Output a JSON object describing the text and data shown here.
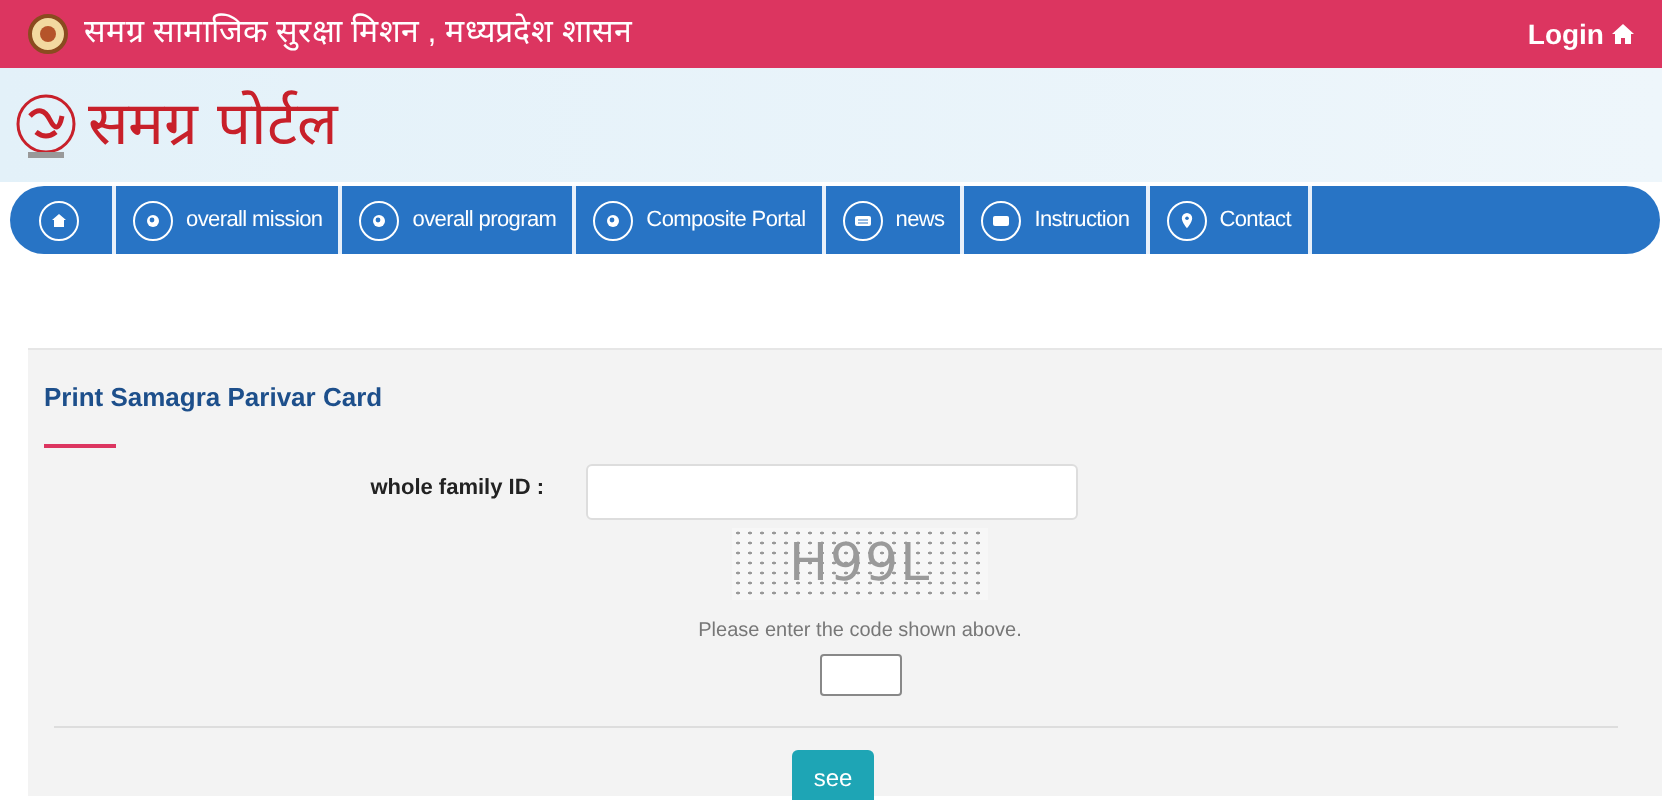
{
  "top_bar": {
    "title": "समग्र सामाजिक सुरक्षा मिशन , मध्यप्रदेश शासन",
    "login": "Login"
  },
  "logo": {
    "text": "समग्र पोर्टल"
  },
  "nav": [
    {
      "kind": "home"
    },
    {
      "kind": "dot",
      "label": "overall mission"
    },
    {
      "kind": "dot",
      "label": "overall program"
    },
    {
      "kind": "dot",
      "label": "Composite Portal"
    },
    {
      "kind": "news",
      "label": "news"
    },
    {
      "kind": "card",
      "label": "Instruction"
    },
    {
      "kind": "pin",
      "label": "Contact"
    }
  ],
  "form": {
    "title": "Print Samagra Parivar Card",
    "field_label": "whole family ID :",
    "captcha": "H99L",
    "captcha_hint": "Please enter the code shown above.",
    "submit": "see"
  }
}
